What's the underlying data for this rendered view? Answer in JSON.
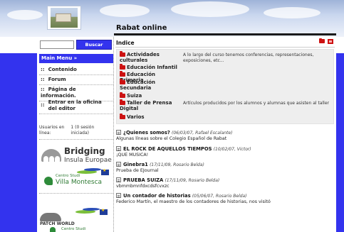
{
  "header": {
    "site_title": "Rabat online"
  },
  "search": {
    "placeholder": "",
    "button_label": "Buscar"
  },
  "sidebar": {
    "menu_title": "Main Menu »",
    "bullet": "::",
    "items": [
      {
        "label": "Contenido"
      },
      {
        "label": "Forum"
      },
      {
        "label": "Página de información."
      },
      {
        "label": "Entrar en la oficina del editor"
      }
    ],
    "users_label": "Usuarios en línea:",
    "users_value": "1 (0 sesión iniciada)"
  },
  "banners": {
    "bridging_title": "Bridging",
    "bridging_subtitle": "Insula Europae",
    "villa_small": "Centro Studi",
    "villa_big": "Villa Montesca",
    "patch_world": "PATCH WORLD",
    "villa_small_2": "Centro Studi"
  },
  "main": {
    "index_title": "Indice",
    "index_icons": [
      "folder-icon",
      "pdf-icon"
    ],
    "categories": [
      {
        "label": "Actividades culturales",
        "description": "A lo largo del curso tenemos conferencias, representaciones, exposiciones, etc..."
      },
      {
        "label": "Educación Infantil",
        "description": ""
      },
      {
        "label": "Educación Primaria",
        "description": ""
      },
      {
        "label": "Educación Secundaria",
        "description": ""
      },
      {
        "label": "Suiza",
        "description": ""
      },
      {
        "label": "Taller de Prensa Digital",
        "description": "Artículos producidos por los alumnos y alumnas que asisten al taller"
      },
      {
        "label": "Varios",
        "description": ""
      }
    ],
    "articles": [
      {
        "title": "¿Quienes somos?",
        "meta": "(06/03/07, Rafael Escalante)",
        "body": "Algunas líneas sobre el Colegio Español de Rabat"
      },
      {
        "title": "EL ROCK DE AQUELLOS TIEMPOS",
        "meta": "(10/02/07, Victor)",
        "body": "¡QUE MUSICA!"
      },
      {
        "title": "Ginebra1",
        "meta": "(17/11/09, Rosario Belda)",
        "body": "Prueba de EJournal"
      },
      {
        "title": "PRUEBA SUIZA",
        "meta": "(17/11/09, Rosario Belda)",
        "body": "vbmmbmnfdxcdsfcvxzc"
      },
      {
        "title": "Un contador de historias",
        "meta": "(05/06/07, Rosario Belda)",
        "body": "Federico Martín, el maestro de los contadores de historias, nos visitó"
      }
    ]
  },
  "colors": {
    "accent_blue": "#3333ee",
    "folder_red": "#cc1111",
    "index_bg": "#eeeeee"
  }
}
